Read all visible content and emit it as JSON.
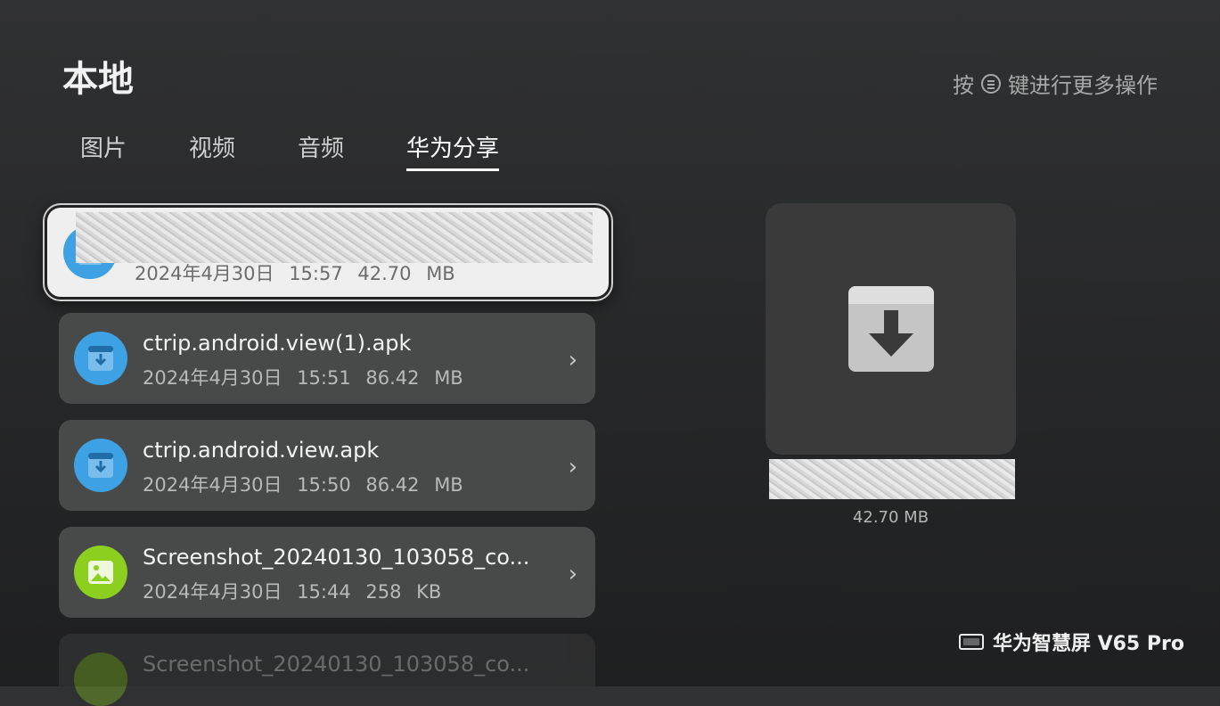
{
  "header": {
    "title": "本地",
    "hint_prefix": "按",
    "hint_icon": "menu-icon",
    "hint_suffix": "键进行更多操作"
  },
  "tabs": [
    {
      "label": "图片",
      "active": false
    },
    {
      "label": "视频",
      "active": false
    },
    {
      "label": "音频",
      "active": false
    },
    {
      "label": "华为分享",
      "active": true
    }
  ],
  "files": [
    {
      "name": "",
      "meta": "2024年4月30日 15:57   42.70 MB",
      "icon": "apk-download-icon",
      "focused": true
    },
    {
      "name": "ctrip.android.view(1).apk",
      "meta": "2024年4月30日 15:51   86.42 MB",
      "icon": "apk-download-icon"
    },
    {
      "name": "ctrip.android.view.apk",
      "meta": "2024年4月30日 15:50   86.42 MB",
      "icon": "apk-download-icon"
    },
    {
      "name": "Screenshot_20240130_103058_co...",
      "meta": "2024年4月30日 15:44   258 KB",
      "icon": "image-icon"
    },
    {
      "name": "Screenshot_20240130_103058_co...",
      "meta": "",
      "icon": "image-icon",
      "faded": true
    }
  ],
  "preview": {
    "icon": "download-icon",
    "size": "42.70 MB"
  },
  "brand": {
    "icon": "tv-icon",
    "label": "华为智慧屏 V65 Pro"
  },
  "colors": {
    "background": "#262728",
    "card": "#484949",
    "focused_card": "#efefef",
    "apk_icon": "#3ea1e4",
    "image_icon": "#8ccf1f"
  }
}
